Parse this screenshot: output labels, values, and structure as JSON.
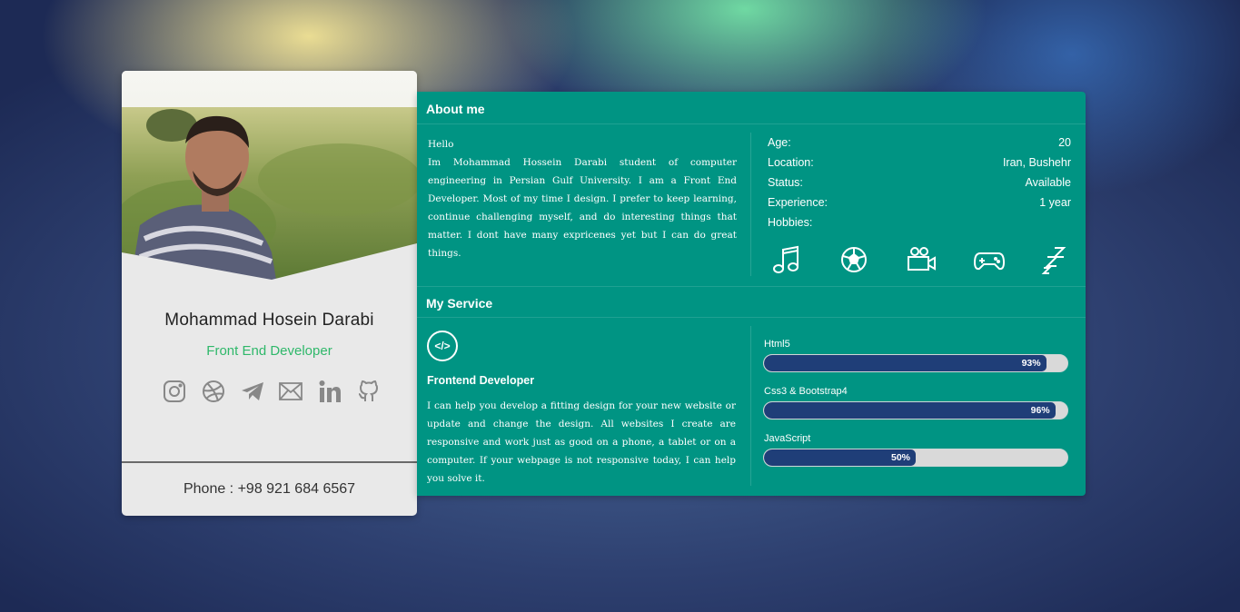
{
  "profile": {
    "name": "Mohammad Hosein Darabi",
    "role": "Front End Developer",
    "phone": "Phone : +98 921 684 6567",
    "socials": [
      "instagram-icon",
      "dribbble-icon",
      "telegram-icon",
      "email-icon",
      "linkedin-icon",
      "github-icon"
    ]
  },
  "about": {
    "title": "About me",
    "greeting": "Hello",
    "text": "Im Mohammad Hossein Darabi student of computer engineering in Persian Gulf University. I am a Front End Developer. Most of my time I design. I prefer to keep learning, continue challenging myself, and do interesting things that matter. I dont have many expricenes yet but I can do great things.",
    "info": [
      {
        "label": "Age:",
        "value": "20"
      },
      {
        "label": "Location:",
        "value": "Iran, Bushehr"
      },
      {
        "label": "Status:",
        "value": "Available"
      },
      {
        "label": "Experience:",
        "value": "1 year"
      },
      {
        "label": "Hobbies:",
        "value": ""
      }
    ],
    "hobbies": [
      "music-icon",
      "football-icon",
      "video-camera-icon",
      "gamepad-icon",
      "sleep-icon"
    ]
  },
  "service": {
    "title": "My Service",
    "icon_text": "</>",
    "name": "Frontend Developer",
    "text": "I can help you develop a fitting design for your new website or update and change the design. All websites I create are responsive and work just as good on a phone, a tablet or on a computer. If your webpage is not responsive today, I can help you solve it."
  },
  "skills": [
    {
      "name": "Html5",
      "percent": 93,
      "label": "93%"
    },
    {
      "name": "Css3 & Bootstrap4",
      "percent": 96,
      "label": "96%"
    },
    {
      "name": "JavaScript",
      "percent": 50,
      "label": "50%"
    }
  ],
  "colors": {
    "accent": "#009483",
    "bar": "#1f3e78",
    "role": "#2fb86a"
  }
}
